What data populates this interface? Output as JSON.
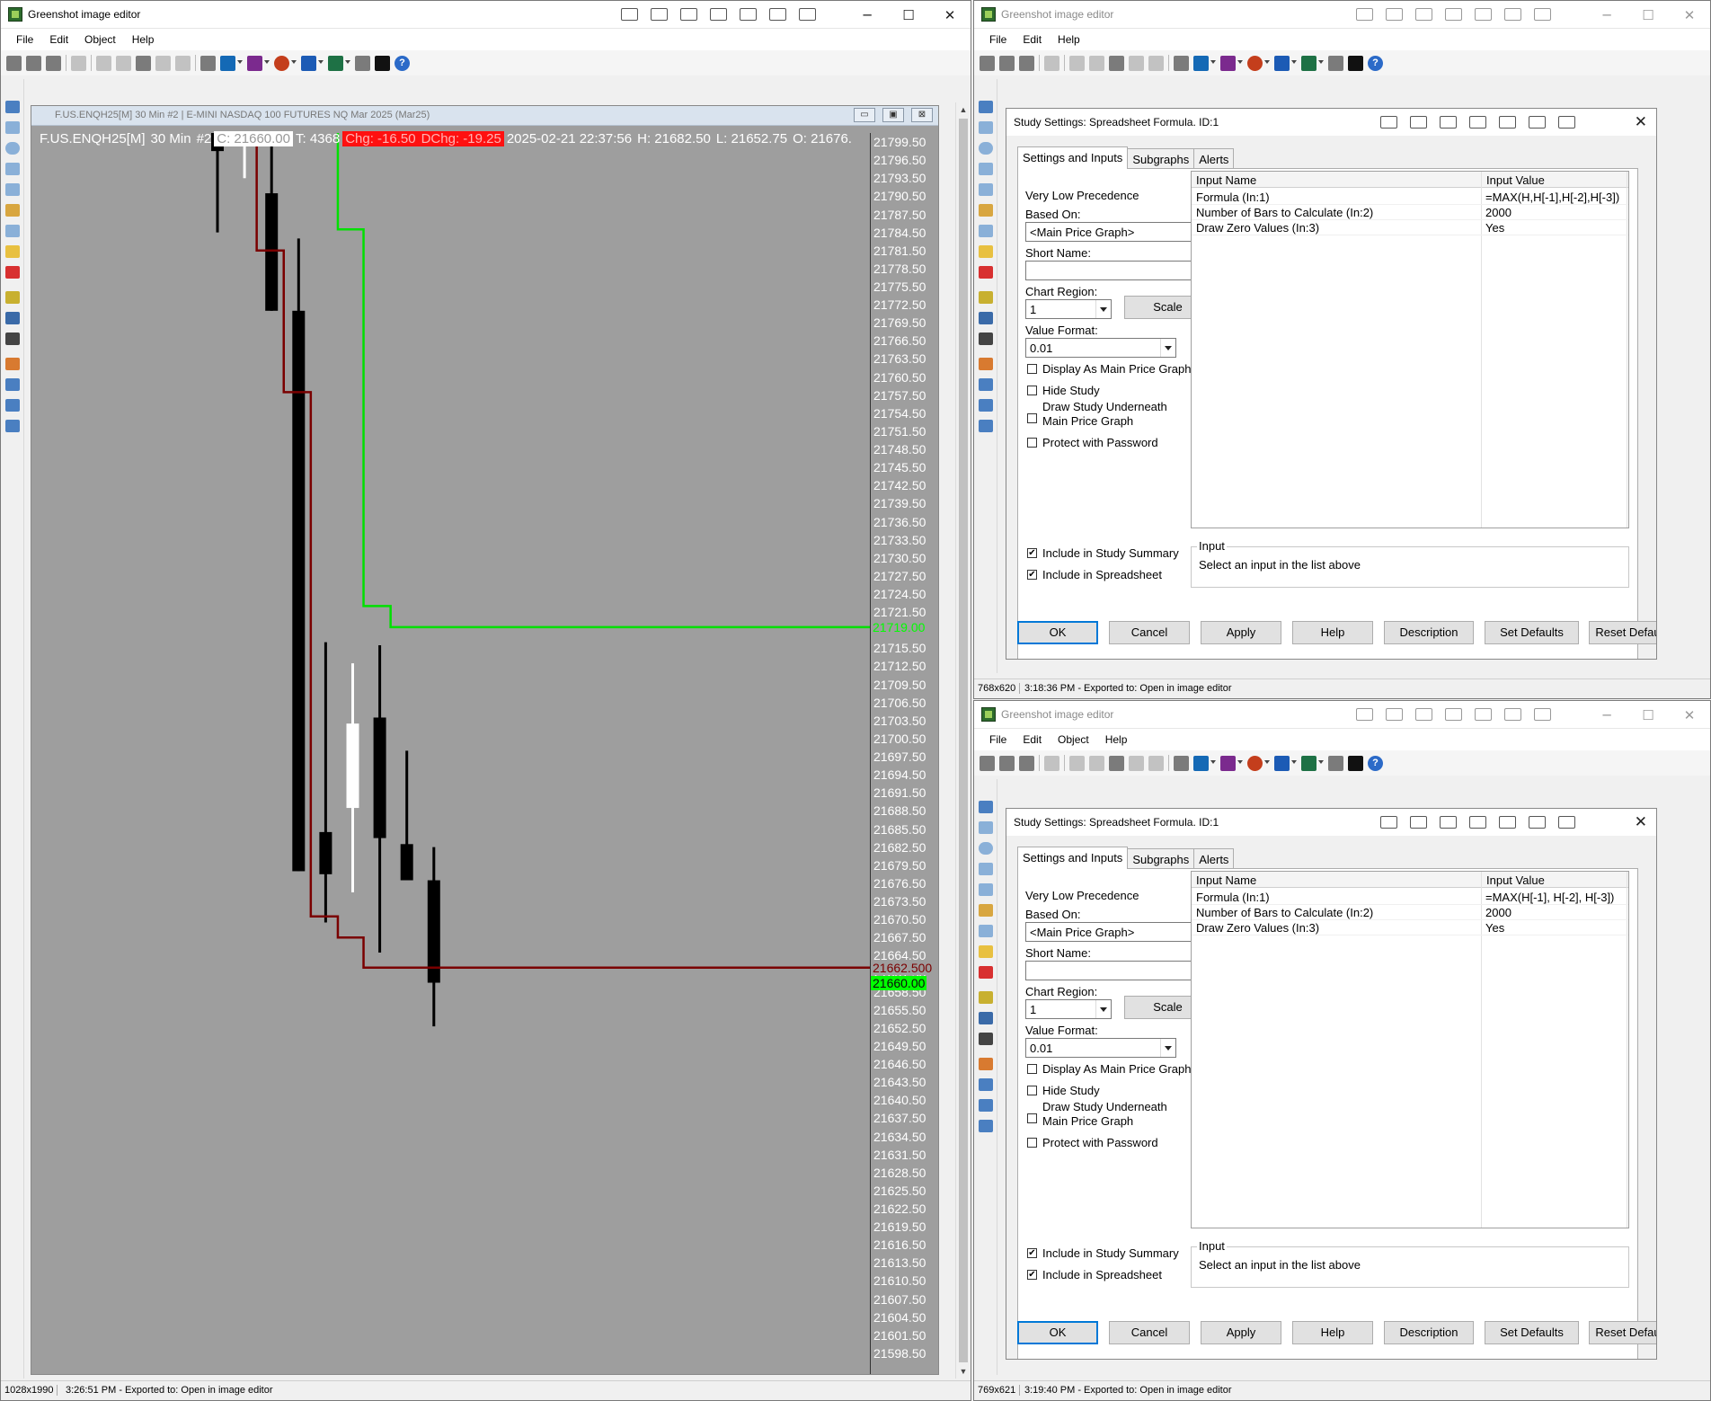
{
  "colors": {
    "chart_bg": "#9e9e9e",
    "upper_line": "#00e000",
    "lower_line": "#7a0000",
    "price_green": "#00ff00",
    "change_red": "#ff1010"
  },
  "left_window": {
    "title": "Greenshot image editor",
    "menu": [
      "File",
      "Edit",
      "Object",
      "Help"
    ],
    "window_controls": [
      "─",
      "☐",
      "✕"
    ],
    "chart_window": {
      "title": "F.US.ENQH25[M]  30 Min  #2 | E-MINI NASDAQ 100 FUTURES NQ Mar 2025 (Mar25)",
      "controls": [
        "▭",
        "▣",
        "⊠"
      ],
      "info": {
        "symbol": "F.US.ENQH25[M]",
        "interval": "30 Min",
        "chart_no": "#2",
        "close": "C: 21660.00",
        "trades": "T: 4368",
        "change": "Chg: -16.50",
        "dchange": "DChg: -19.25",
        "datetime": "2025-02-21 22:37:56",
        "high": "H: 21682.50",
        "low": "L: 21652.75",
        "open": "O: 21676."
      }
    },
    "status": {
      "size": "1028x1990",
      "message": "3:26:51 PM - Exported to: Open in image editor"
    }
  },
  "chart_data": {
    "type": "candlestick",
    "y_range": [
      21597.0,
      21801.0
    ],
    "price_ticks": [
      21799.5,
      21796.5,
      21793.5,
      21790.5,
      21787.5,
      21784.5,
      21781.5,
      21778.5,
      21775.5,
      21772.5,
      21769.5,
      21766.5,
      21763.5,
      21760.5,
      21757.5,
      21754.5,
      21751.5,
      21748.5,
      21745.5,
      21742.5,
      21739.5,
      21736.5,
      21733.5,
      21730.5,
      21727.5,
      21724.5,
      21721.5,
      21718.5,
      21715.5,
      21712.5,
      21709.5,
      21706.5,
      21703.5,
      21700.5,
      21697.5,
      21694.5,
      21691.5,
      21688.5,
      21685.5,
      21682.5,
      21679.5,
      21676.5,
      21673.5,
      21670.5,
      21667.5,
      21664.5,
      21661.5,
      21658.5,
      21655.5,
      21652.5,
      21649.5,
      21646.5,
      21643.5,
      21640.5,
      21637.5,
      21634.5,
      21631.5,
      21628.5,
      21625.5,
      21622.5,
      21619.5,
      21616.5,
      21613.5,
      21610.5,
      21607.5,
      21604.5,
      21601.5,
      21598.5
    ],
    "candles": [
      {
        "open": 21801.0,
        "high": 21801.0,
        "low": 21784.5,
        "close": 21798.0
      },
      {
        "open": 21799.0,
        "high": 21800.5,
        "low": 21793.5,
        "close": 21800.0
      },
      {
        "open": 21791.0,
        "high": 21799.5,
        "low": 21771.5,
        "close": 21771.5
      },
      {
        "open": 21771.5,
        "high": 21783.5,
        "low": 21678.5,
        "close": 21678.5
      },
      {
        "open": 21685.0,
        "high": 21716.5,
        "low": 21670.0,
        "close": 21678.0
      },
      {
        "open": 21689.0,
        "high": 21713.0,
        "low": 21675.0,
        "close": 21703.0
      },
      {
        "open": 21704.0,
        "high": 21716.0,
        "low": 21665.0,
        "close": 21684.0
      },
      {
        "open": 21683.0,
        "high": 21698.5,
        "low": 21677.0,
        "close": 21677.0
      },
      {
        "open": 21677.0,
        "high": 21682.5,
        "low": 21652.75,
        "close": 21660.0
      }
    ],
    "upper_line_value": 21719.0,
    "upper_line_label": "21719.00",
    "lower_line_value": 21662.5,
    "lower_line_label": "21662.500",
    "last_price_label": "21660.00",
    "upper_step": [
      {
        "bar": 4.45,
        "value": 21801.0
      },
      {
        "bar": 4.45,
        "value": 21785.0
      },
      {
        "bar": 5.4,
        "value": 21785.0
      },
      {
        "bar": 5.4,
        "value": 21722.5
      },
      {
        "bar": 6.4,
        "value": 21722.5
      },
      {
        "bar": 6.4,
        "value": 21719.0
      }
    ],
    "lower_step": [
      {
        "bar": 1.45,
        "value": 21801.0
      },
      {
        "bar": 1.45,
        "value": 21781.5
      },
      {
        "bar": 2.45,
        "value": 21781.5
      },
      {
        "bar": 2.45,
        "value": 21758.0
      },
      {
        "bar": 3.45,
        "value": 21758.0
      },
      {
        "bar": 3.45,
        "value": 21671.0
      },
      {
        "bar": 4.45,
        "value": 21671.0
      },
      {
        "bar": 4.45,
        "value": 21667.5
      },
      {
        "bar": 5.4,
        "value": 21667.5
      },
      {
        "bar": 5.4,
        "value": 21662.5
      }
    ]
  },
  "dialogs": [
    {
      "window_title": "Greenshot image editor",
      "menu": [
        "File",
        "Edit",
        "Help"
      ],
      "window_controls": [
        "─",
        "☐",
        "✕"
      ],
      "title": "Study Settings: Spreadsheet Formula. ID:1",
      "tabs": [
        "Settings and Inputs",
        "Subgraphs",
        "Alerts"
      ],
      "precedence": "Very Low Precedence",
      "based_on_label": "Based On:",
      "based_on_value": "<Main Price Graph>",
      "short_name_label": "Short Name:",
      "chart_region_label": "Chart Region:",
      "chart_region_value": "1",
      "scale_button": "Scale",
      "value_format_label": "Value Format:",
      "value_format_value": "0.01",
      "checkboxes": [
        {
          "label": "Display As Main Price Graph",
          "checked": false
        },
        {
          "label": "Hide Study",
          "checked": false
        },
        {
          "label": "Draw Study Underneath\nMain Price Graph",
          "checked": false
        },
        {
          "label": "Protect with Password",
          "checked": false
        }
      ],
      "bottom_checkboxes": [
        {
          "label": "Include in Study Summary",
          "checked": true
        },
        {
          "label": "Include in Spreadsheet",
          "checked": true
        }
      ],
      "grid_headers": [
        "Input Name",
        "Input Value"
      ],
      "inputs": [
        {
          "name": "Formula   (In:1)",
          "value": "=MAX(H,H[-1],H[-2],H[-3])"
        },
        {
          "name": "Number of Bars to Calculate   (In:2)",
          "value": "2000"
        },
        {
          "name": "Draw Zero Values   (In:3)",
          "value": "Yes"
        }
      ],
      "input_group_title": "Input",
      "input_group_text": "Select an input in the list above",
      "buttons": [
        "OK",
        "Cancel",
        "Apply",
        "Help",
        "Description",
        "Set Defaults",
        "Reset Defaults"
      ],
      "check_mark": "✔",
      "status": {
        "size": "768x620",
        "message": "3:18:36 PM - Exported to: Open in image editor"
      }
    },
    {
      "window_title": "Greenshot image editor",
      "menu": [
        "File",
        "Edit",
        "Object",
        "Help"
      ],
      "window_controls": [
        "─",
        "☐",
        "✕"
      ],
      "title": "Study Settings: Spreadsheet Formula. ID:1",
      "tabs": [
        "Settings and Inputs",
        "Subgraphs",
        "Alerts"
      ],
      "precedence": "Very Low Precedence",
      "based_on_label": "Based On:",
      "based_on_value": "<Main Price Graph>",
      "short_name_label": "Short Name:",
      "chart_region_label": "Chart Region:",
      "chart_region_value": "1",
      "scale_button": "Scale",
      "value_format_label": "Value Format:",
      "value_format_value": "0.01",
      "checkboxes": [
        {
          "label": "Display As Main Price Graph",
          "checked": false
        },
        {
          "label": "Hide Study",
          "checked": false
        },
        {
          "label": "Draw Study Underneath\nMain Price Graph",
          "checked": false
        },
        {
          "label": "Protect with Password",
          "checked": false
        }
      ],
      "bottom_checkboxes": [
        {
          "label": "Include in Study Summary",
          "checked": true
        },
        {
          "label": "Include in Spreadsheet",
          "checked": true
        }
      ],
      "grid_headers": [
        "Input Name",
        "Input Value"
      ],
      "inputs": [
        {
          "name": "Formula   (In:1)",
          "value": "=MAX(H[-1], H[-2], H[-3])"
        },
        {
          "name": "Number of Bars to Calculate   (In:2)",
          "value": "2000"
        },
        {
          "name": "Draw Zero Values   (In:3)",
          "value": "Yes"
        }
      ],
      "input_group_title": "Input",
      "input_group_text": "Select an input in the list above",
      "buttons": [
        "OK",
        "Cancel",
        "Apply",
        "Help",
        "Description",
        "Set Defaults",
        "Reset Defaults"
      ],
      "check_mark": "✔",
      "status": {
        "size": "769x621",
        "message": "3:19:40 PM - Exported to: Open in image editor"
      }
    }
  ]
}
